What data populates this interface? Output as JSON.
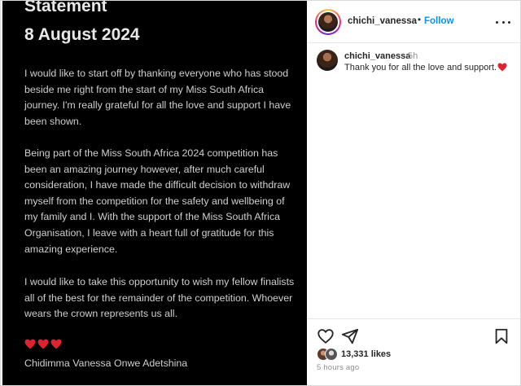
{
  "post": {
    "title": "Statement",
    "date": "8 August 2024",
    "paragraphs": [
      "I would like to start off by thanking everyone who has stood beside me right from the start of my Miss South Africa journey. I'm really grateful for all the love and support I have been shown.",
      "Being part of the Miss South Africa 2024 competition has been an amazing journey however, after much careful consideration, I have made the difficult decision to withdraw myself from the competition for the safety and wellbeing of my family and I. With the support of the Miss South Africa Organisation, I leave with a heart full of gratitude for this amazing experience.",
      "I would like to take this opportunity to wish my fellow finalists all of the best for the remainder of the competition. Whoever wears the crown represents us all."
    ],
    "hearts_count": 3,
    "heart_color": "#e0242f",
    "signature": "Chidimma Vanessa Onwe Adetshina"
  },
  "header": {
    "username": "chichi_vanessa",
    "separator": "•",
    "follow_label": "Follow",
    "more_icon": "more-horizontal-icon"
  },
  "comment": {
    "username": "chichi_vanessa",
    "time": "5h",
    "text": "Thank you for all the love and support."
  },
  "actions": {
    "like_icon": "heart-outline-icon",
    "share_icon": "paper-plane-icon",
    "save_icon": "bookmark-icon"
  },
  "stats": {
    "likes": "13,331 likes",
    "posted": "5 hours ago"
  },
  "colors": {
    "follow": "#0095f6",
    "image_bg": "#000000",
    "heart": "#e0242f"
  }
}
